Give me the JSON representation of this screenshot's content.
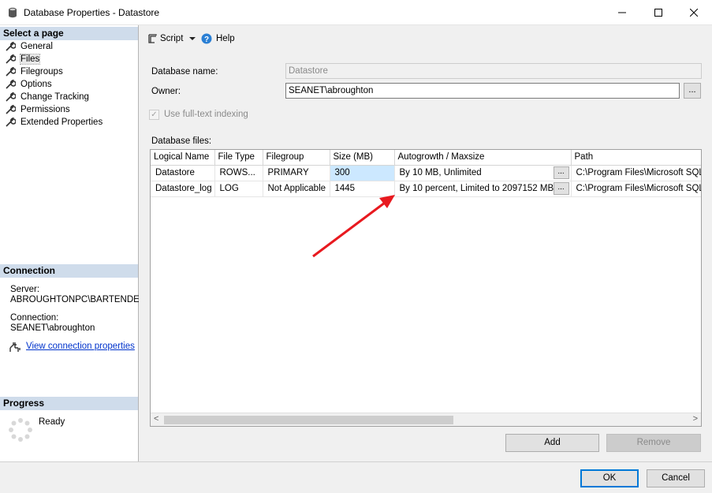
{
  "window": {
    "title": "Database Properties - Datastore",
    "minimize": "—",
    "maximize": "☐",
    "close": "✕"
  },
  "left": {
    "select_page_header": "Select a page",
    "pages": [
      "General",
      "Files",
      "Filegroups",
      "Options",
      "Change Tracking",
      "Permissions",
      "Extended Properties"
    ],
    "selected_page": "Files",
    "connection_header": "Connection",
    "server_label": "Server:",
    "server_value": "ABROUGHTONPC\\BARTENDER",
    "connection_label": "Connection:",
    "connection_value": "SEANET\\abroughton",
    "view_connection_link": "View connection properties",
    "progress_header": "Progress",
    "progress_status": "Ready"
  },
  "toolbar": {
    "script_label": "Script",
    "help_label": "Help"
  },
  "form": {
    "db_name_label": "Database name:",
    "db_name_value": "Datastore",
    "owner_label": "Owner:",
    "owner_value": "SEANET\\abroughton",
    "fulltext_label": "Use full-text indexing",
    "fulltext_checked": true,
    "ellipsis": "...",
    "db_files_label": "Database files:"
  },
  "grid": {
    "columns": [
      "Logical Name",
      "File Type",
      "Filegroup",
      "Size (MB)",
      "Autogrowth / Maxsize",
      "Path"
    ],
    "rows": [
      [
        "Datastore",
        "ROWS...",
        "PRIMARY",
        "300",
        "By 10 MB, Unlimited",
        "C:\\Program Files\\Microsoft SQL Se"
      ],
      [
        "Datastore_log",
        "LOG",
        "Not Applicable",
        "1445",
        "By 10 percent, Limited to 2097152 MB",
        "C:\\Program Files\\Microsoft SQL Se"
      ]
    ],
    "cell_ellipsis": "...",
    "scroll_left": "<",
    "scroll_right": ">"
  },
  "buttons": {
    "add": "Add",
    "remove": "Remove",
    "ok": "OK",
    "cancel": "Cancel"
  },
  "colors": {
    "section_header": "#cfdceb",
    "selected_cell": "#cce8ff",
    "arrow": "#e8191f",
    "link": "#0033cc"
  }
}
